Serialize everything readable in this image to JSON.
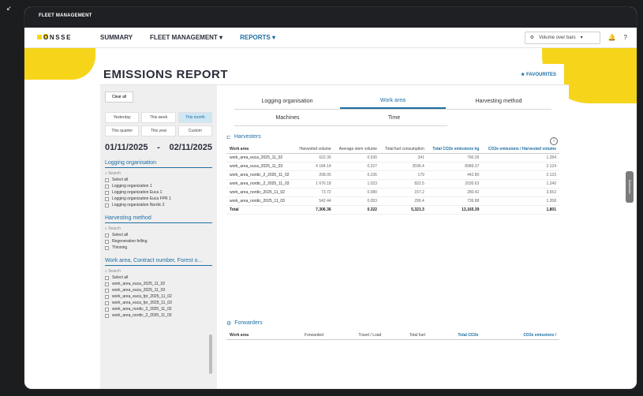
{
  "frame": {
    "top_title": "FLEET MANAGEMENT"
  },
  "nav": {
    "logo": "ONSSE",
    "items": [
      {
        "label": "SUMMARY",
        "active": false
      },
      {
        "label": "FLEET MANAGEMENT",
        "active": false
      },
      {
        "label": "REPORTS",
        "active": true
      }
    ],
    "selector": "Volume over bars"
  },
  "report": {
    "title": "EMISSIONS REPORT",
    "favourites": "FAVOURITES"
  },
  "left": {
    "clear": "Clear all",
    "presets": [
      "Yesterday",
      "This week",
      "This month",
      "This quarter",
      "This year",
      "Custom"
    ],
    "dates": {
      "from": "01/11/2025",
      "to": "02/11/2025"
    },
    "sections": [
      {
        "title": "Logging organisation",
        "search": "Search",
        "items": [
          "Select all",
          "Logging organization 1",
          "Logging organization Euca 1",
          "Logging organization Euca FPR 1",
          "Logging organization Nordic 2"
        ]
      },
      {
        "title": "Harvesting method",
        "search": "Search",
        "items": [
          "Select all",
          "Regeneration felling",
          "Thinning"
        ]
      },
      {
        "title": "Work area, Contract number, Forest o...",
        "search": "Search",
        "items": [
          "Select all",
          "work_area_euca_2025_11_02",
          "work_area_euca_2025_11_03",
          "work_area_euca_fpr_2025_11_02",
          "work_area_euca_fpr_2025_11_03",
          "work_area_nordic_2_2025_11_02",
          "work_area_nordic_2_2025_11_03"
        ]
      }
    ]
  },
  "tabs": {
    "row1": [
      {
        "label": "Logging organisation",
        "active": false
      },
      {
        "label": "Work area",
        "active": true
      },
      {
        "label": "Harvesting method",
        "active": false
      }
    ],
    "row2": [
      {
        "label": "Machines"
      },
      {
        "label": "Time"
      }
    ]
  },
  "harvesters": {
    "title": "Harvesters",
    "headers": [
      "Work area",
      "Harvested volume",
      "Average stem volume",
      "Total fuel consumption",
      "Total CO2e emissions kg",
      "CO2e emissions / Harvested volume"
    ],
    "rows": [
      [
        "work_area_euca_2025_11_02",
        "622.35",
        "0.530",
        "341",
        "790.35",
        "1.284"
      ],
      [
        "work_area_euca_2025_11_03",
        "4 184.14",
        "0.227",
        "3596.4",
        "8989.37",
        "2.124"
      ],
      [
        "work_area_nordic_2_2025_11_02",
        "208.05",
        "0.236",
        "179",
        "442.80",
        "2.123"
      ],
      [
        "work_area_nordic_2_2025_11_03",
        "1 676.18",
        "1.023",
        "822.5",
        "2030.63",
        "1.240"
      ],
      [
        "work_area_nordic_2025_11_02",
        "73.72",
        "0.080",
        "157.2",
        "280.42",
        "3.653"
      ],
      [
        "work_area_nordic_2025_11_03",
        "542.44",
        "0.053",
        "296.4",
        "736.88",
        "1.358"
      ]
    ],
    "total": [
      "Total",
      "7,306.36",
      "0.322",
      "5,321.3",
      "13,165.39",
      "1,801"
    ]
  },
  "forwarders": {
    "title": "Forwarders",
    "headers": [
      "Work area",
      "Forwarded",
      "Travel / Load",
      "Total fuel",
      "Total CO2e",
      "CO2e emissions /"
    ]
  },
  "side_tab": "Bokmarks",
  "colors": {
    "accent": "#1d6fa4",
    "brand_yellow": "#f6d41a"
  }
}
